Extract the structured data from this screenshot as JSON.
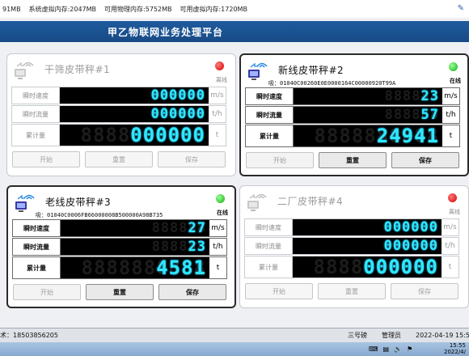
{
  "topbar": {
    "items": [
      "91MB",
      "系统虚拟内存:2047MB",
      "可用物理内存:5752MB",
      "可用虚拟内存:1720MB"
    ],
    "icon": "pin-icon"
  },
  "app": {
    "title": "甲乙物联网业务处理平台"
  },
  "colors": {
    "title_bar": "#1f5b9e",
    "digits": "#2ee8ff",
    "online_led": "#10b010",
    "offline_led": "#d40000"
  },
  "panels": [
    {
      "name": "干筛皮带秤#1",
      "status": "离线",
      "device_id": "",
      "rows": [
        {
          "label": "瞬时速度",
          "ghost": "888888",
          "value": "000000",
          "unit": "m/s"
        },
        {
          "label": "瞬时流量",
          "ghost": "888888",
          "value": "000000",
          "unit": "t/h"
        },
        {
          "label": "累计量",
          "ghost": "8888888888",
          "value": "000000",
          "unit": "t"
        }
      ],
      "buttons": [
        "开始",
        "重置",
        "保存"
      ]
    },
    {
      "name": "新线皮带秤#2",
      "status": "在线",
      "device_id": "吸：01040C00260E0E0000164C00000920T99A",
      "rows": [
        {
          "label": "瞬时速度",
          "ghost": "888888",
          "value": "23",
          "unit": "m/s"
        },
        {
          "label": "瞬时流量",
          "ghost": "888888",
          "value": "57",
          "unit": "t/h"
        },
        {
          "label": "累计量",
          "ghost": "8888888888",
          "value": "24941",
          "unit": "t"
        }
      ],
      "buttons": [
        "开始",
        "重置",
        "保存"
      ]
    },
    {
      "name": "老线皮带秤#3",
      "status": "在线",
      "device_id": "吸：01040C0006FB66000008B500000A98B735",
      "rows": [
        {
          "label": "瞬时速度",
          "ghost": "888888",
          "value": "27",
          "unit": "m/s"
        },
        {
          "label": "瞬时流量",
          "ghost": "888888",
          "value": "23",
          "unit": "t/h"
        },
        {
          "label": "累计量",
          "ghost": "8888888888",
          "value": "4581",
          "unit": "t"
        }
      ],
      "buttons": [
        "开始",
        "重置",
        "保存"
      ]
    },
    {
      "name": "二厂皮带秤#4",
      "status": "离线",
      "device_id": "",
      "rows": [
        {
          "label": "瞬时速度",
          "ghost": "888888",
          "value": "000000",
          "unit": "m/s"
        },
        {
          "label": "瞬时流量",
          "ghost": "888888",
          "value": "000000",
          "unit": "t/h"
        },
        {
          "label": "累计量",
          "ghost": "8888888888",
          "value": "000000",
          "unit": "t"
        }
      ],
      "buttons": [
        "开始",
        "重置",
        "保存"
      ]
    }
  ],
  "statusbar": {
    "support": "术：18503856205",
    "station": "三号磅",
    "role": "管理员",
    "datetime": "2022-04-19 15:55"
  },
  "taskbar": {
    "tray_icons": [
      "keyboard-icon",
      "network-icon",
      "volume-icon",
      "flag-icon"
    ],
    "time": "15:55",
    "date": "2022/4/"
  }
}
